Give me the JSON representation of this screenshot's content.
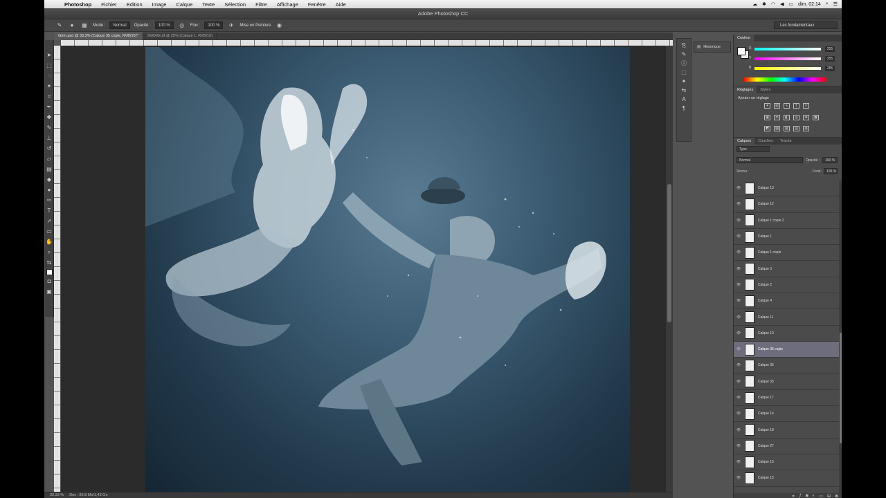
{
  "menubar": {
    "items": [
      "Photoshop",
      "Fichier",
      "Edition",
      "Image",
      "Calque",
      "Texte",
      "Sélection",
      "Filtre",
      "Affichage",
      "Fenêtre",
      "Aide"
    ],
    "clock": "dim. 02:14"
  },
  "window": {
    "title": "Adobe Photoshop CC"
  },
  "options": {
    "mode_label": "Mode :",
    "mode_value": "Normal",
    "opacity_label": "Opacité :",
    "opacity_value": "100 %",
    "flow_label": "Flux :",
    "flow_value": "100 %",
    "airbrush_label": "Mise en Peinture",
    "workspace": "Les fondamentaux"
  },
  "doc_tabs": [
    {
      "label": "Grim.psd @ 33,3% (Calque 35 copie, RVB/16)*",
      "active": true
    },
    {
      "label": "SMOKE.tif @ 25% (Calque 1, RVB/16)",
      "active": false
    }
  ],
  "status": {
    "zoom": "33,33 %",
    "doc": "Doc : 89,8 Mo/1,43 Go"
  },
  "history": {
    "label": "Historique"
  },
  "color_panel": {
    "tab": "Couleur",
    "sliders": [
      {
        "label": "R",
        "value": "255"
      },
      {
        "label": "V",
        "value": "255"
      },
      {
        "label": "B",
        "value": "255"
      }
    ]
  },
  "adjustments": {
    "tabs": [
      "Réglages",
      "Styles"
    ],
    "title": "Ajouter un réglage"
  },
  "layers_panel": {
    "tabs": [
      "Calques",
      "Couches",
      "Tracés"
    ],
    "kind": "Type",
    "blend_mode": "Normal",
    "opacity_label": "Opacité :",
    "opacity_value": "100 %",
    "lock_label": "Verrou :",
    "fill_label": "Fond :",
    "fill_value": "100 %",
    "layers": [
      {
        "name": "Calque 13",
        "selected": false
      },
      {
        "name": "Calque 12",
        "selected": false
      },
      {
        "name": "Calque 1 copie 2",
        "selected": false
      },
      {
        "name": "Calque 1",
        "selected": false
      },
      {
        "name": "Calque 1 copie",
        "selected": false
      },
      {
        "name": "Calque 3",
        "selected": false
      },
      {
        "name": "Calque 2",
        "selected": false
      },
      {
        "name": "Calque 4",
        "selected": false
      },
      {
        "name": "Calque 11",
        "selected": false
      },
      {
        "name": "Calque 10",
        "selected": false
      },
      {
        "name": "Calque 35 copie",
        "selected": true
      },
      {
        "name": "Calque 35",
        "selected": false
      },
      {
        "name": "Calque 33",
        "selected": false
      },
      {
        "name": "Calque 17",
        "selected": false
      },
      {
        "name": "Calque 14",
        "selected": false
      },
      {
        "name": "Calque 18",
        "selected": false
      },
      {
        "name": "Calque 27",
        "selected": false
      },
      {
        "name": "Calque 16",
        "selected": false
      },
      {
        "name": "Calque 15",
        "selected": false
      }
    ]
  }
}
